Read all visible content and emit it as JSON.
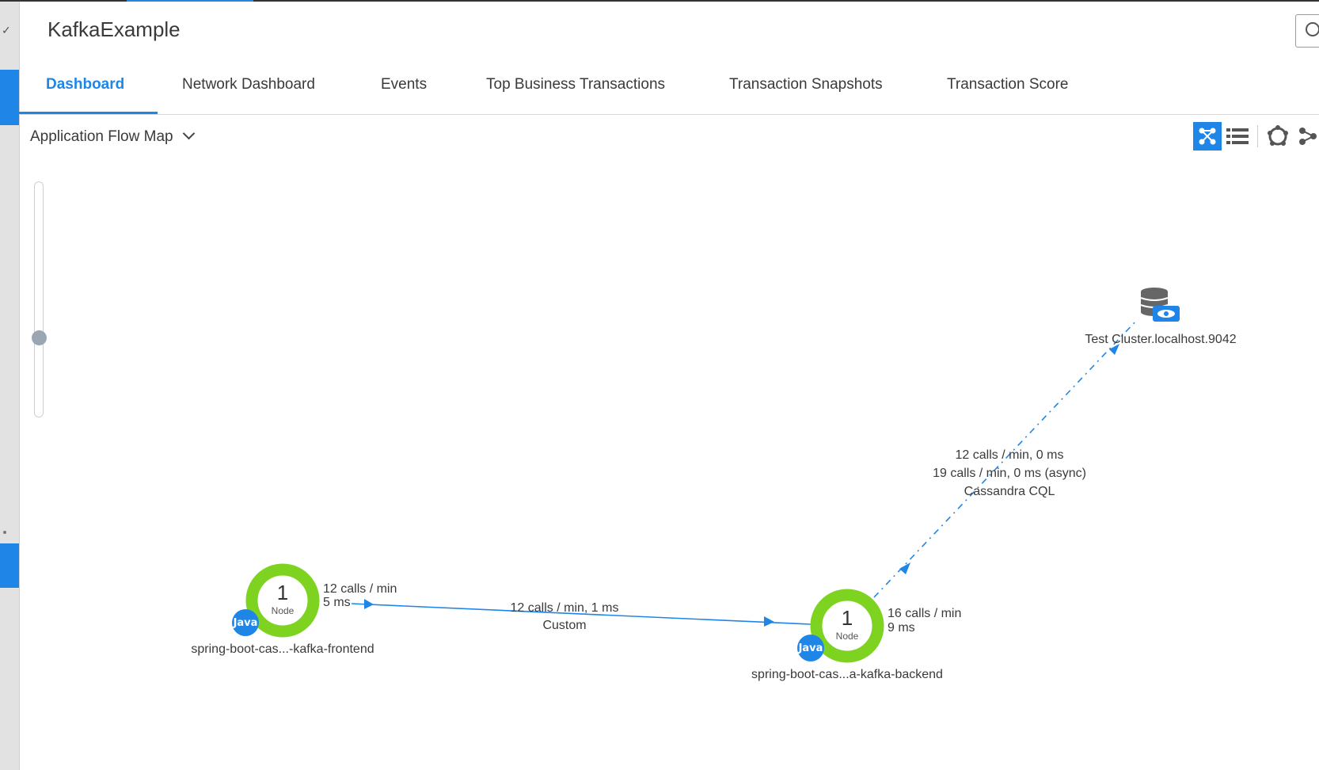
{
  "app": {
    "title": "KafkaExample"
  },
  "tabs": [
    {
      "label": "Dashboard",
      "active": true
    },
    {
      "label": "Network Dashboard"
    },
    {
      "label": "Events"
    },
    {
      "label": "Top Business Transactions"
    },
    {
      "label": "Transaction Snapshots"
    },
    {
      "label": "Transaction Score"
    }
  ],
  "view": {
    "selector_label": "Application Flow Map"
  },
  "toolbar": {
    "items": [
      {
        "icon": "flow-map-icon",
        "active": true
      },
      {
        "icon": "list-view-icon",
        "active": false
      },
      {
        "icon": "circle-layout-icon",
        "active": false
      },
      {
        "icon": "cluster-layout-icon",
        "active": false
      }
    ]
  },
  "flowmap": {
    "nodes": [
      {
        "count": "1",
        "word": "Node",
        "badge": "Java",
        "name": "spring-boot-cas...-kafka-frontend"
      },
      {
        "count": "1",
        "word": "Node",
        "badge": "Java",
        "name": "spring-boot-cas...a-kafka-backend"
      }
    ],
    "frontend_stats": {
      "line1": "12 calls / min",
      "line2": "5 ms"
    },
    "backend_stats": {
      "line1": "16 calls / min",
      "line2": "9 ms"
    },
    "edge_custom": {
      "line1": "12 calls / min, 1 ms",
      "line2": "Custom"
    },
    "edge_cassandra": {
      "line1": "12 calls / min, 0 ms",
      "line2": "19 calls / min, 0 ms (async)",
      "line3": "Cassandra CQL"
    },
    "database": {
      "name": "Test Cluster.localhost.9042",
      "icon": "database-icon"
    },
    "colors": {
      "node_ring": "#7ed321",
      "accent": "#1f86e8",
      "edge": "#1f86e8"
    }
  }
}
